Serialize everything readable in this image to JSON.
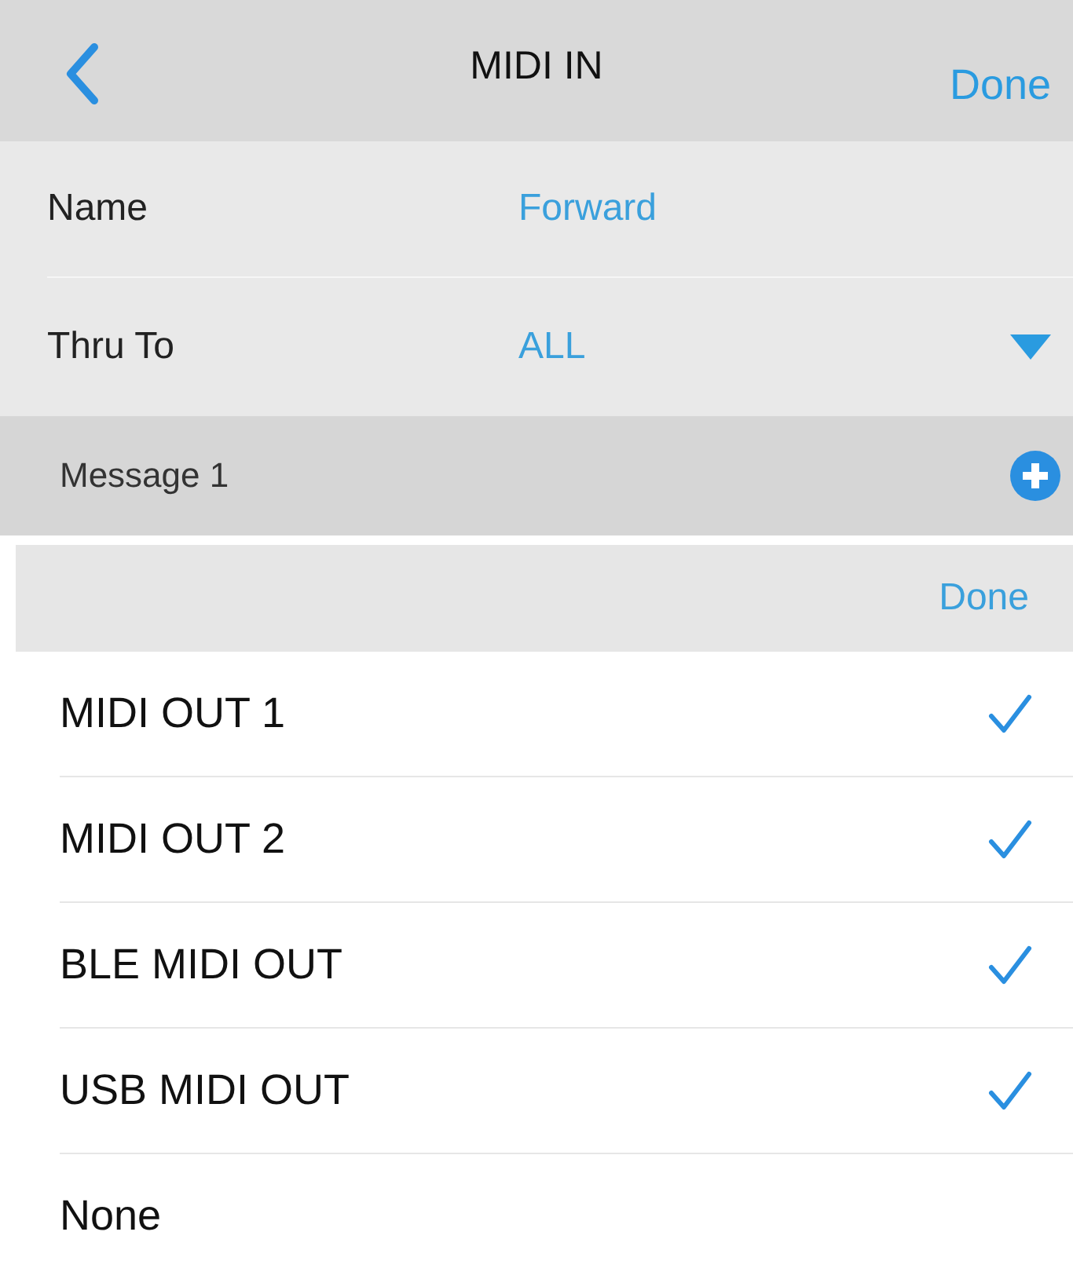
{
  "nav": {
    "title": "MIDI IN",
    "done": "Done"
  },
  "fields": [
    {
      "label": "Name",
      "value": "Forward",
      "kind": "text"
    },
    {
      "label": "Thru To",
      "value": "ALL",
      "kind": "dropdown"
    }
  ],
  "section": {
    "title": "Message 1"
  },
  "picker": {
    "done": "Done",
    "options": [
      {
        "label": "MIDI OUT 1",
        "checked": true
      },
      {
        "label": "MIDI OUT 2",
        "checked": true
      },
      {
        "label": "BLE MIDI OUT",
        "checked": true
      },
      {
        "label": "USB MIDI OUT",
        "checked": true
      },
      {
        "label": "None",
        "checked": false
      }
    ]
  }
}
